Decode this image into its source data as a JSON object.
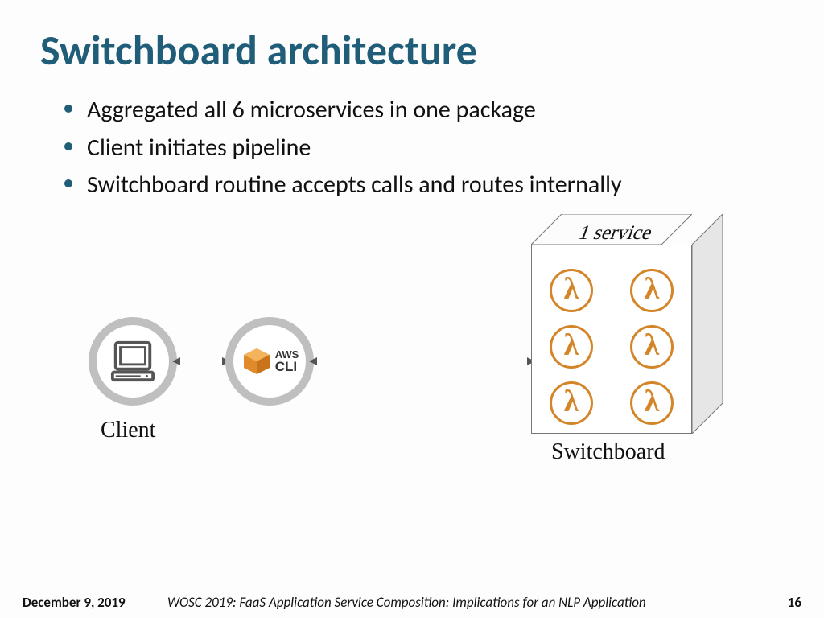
{
  "title": "Switchboard architecture",
  "bullets": [
    "Aggregated all 6 microservices in one package",
    "Client initiates pipeline",
    "Switchboard routine accepts calls and routes internally"
  ],
  "diagram": {
    "client_label": "Client",
    "aws_top": "AWS",
    "aws_bottom": "CLI",
    "service_top_label": "1 service",
    "switchboard_label": "Switchboard",
    "lambda_count": 6
  },
  "footer": {
    "date": "December 9, 2019",
    "center": "WOSC 2019: FaaS Application Service Composition: Implications for an NLP Application",
    "page": "16"
  },
  "colors": {
    "title": "#1f5d78",
    "lambda": "#d48528",
    "circle_border": "#bfbfbf"
  }
}
